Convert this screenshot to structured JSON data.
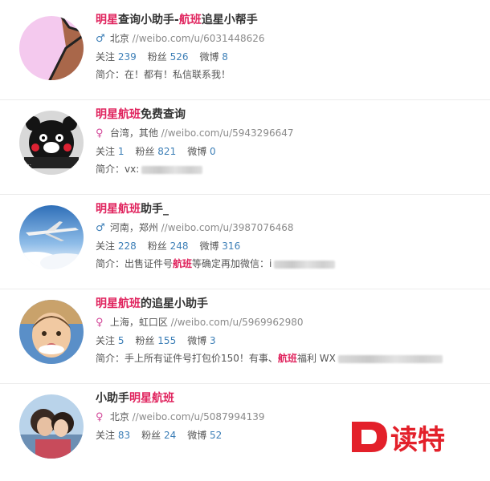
{
  "results": [
    {
      "title_parts": [
        {
          "text": "明星",
          "hl": true
        },
        {
          "text": "查询小助手-",
          "hl": false
        },
        {
          "text": "航班",
          "hl": true
        },
        {
          "text": "追星小帮手",
          "hl": false
        }
      ],
      "gender": "male",
      "location": "北京",
      "url": "//weibo.com/u/6031448626",
      "follow_label": "关注",
      "follow": "239",
      "fans_label": "粉丝",
      "fans": "526",
      "weibo_label": "微博",
      "weibo": "8",
      "bio_label": "简介：",
      "bio_parts": [
        {
          "text": "在！都有！私信联系我！",
          "hl": false
        }
      ],
      "avatar": "pink-abstract"
    },
    {
      "title_parts": [
        {
          "text": "明星",
          "hl": true
        },
        {
          "text": "航班",
          "hl": true
        },
        {
          "text": "免费查询",
          "hl": false
        }
      ],
      "gender": "female",
      "location": "台湾，其他",
      "url": "//weibo.com/u/5943296647",
      "follow_label": "关注",
      "follow": "1",
      "fans_label": "粉丝",
      "fans": "821",
      "weibo_label": "微博",
      "weibo": "0",
      "bio_label": "简介：",
      "bio_parts": [
        {
          "text": "vx:",
          "hl": false
        }
      ],
      "bio_blur": true,
      "avatar": "kumamon"
    },
    {
      "title_parts": [
        {
          "text": "明星",
          "hl": true
        },
        {
          "text": "航班",
          "hl": true
        },
        {
          "text": "助手_",
          "hl": false
        }
      ],
      "gender": "male",
      "location": "河南，郑州",
      "url": "//weibo.com/u/3987076468",
      "follow_label": "关注",
      "follow": "228",
      "fans_label": "粉丝",
      "fans": "248",
      "weibo_label": "微博",
      "weibo": "316",
      "bio_label": "简介：",
      "bio_parts": [
        {
          "text": "出售证件号",
          "hl": false
        },
        {
          "text": "航班",
          "hl": true
        },
        {
          "text": "等确定再加微信：i",
          "hl": false
        }
      ],
      "bio_blur": true,
      "avatar": "airplane"
    },
    {
      "title_parts": [
        {
          "text": "明星",
          "hl": true
        },
        {
          "text": "航班",
          "hl": true
        },
        {
          "text": "的追星小助手",
          "hl": false
        }
      ],
      "gender": "female",
      "location": "上海，虹口区",
      "url": "//weibo.com/u/5969962980",
      "follow_label": "关注",
      "follow": "5",
      "fans_label": "粉丝",
      "fans": "155",
      "weibo_label": "微博",
      "weibo": "3",
      "bio_label": "简介：",
      "bio_parts": [
        {
          "text": "手上所有证件号打包价150！有事、",
          "hl": false
        },
        {
          "text": "航班",
          "hl": true
        },
        {
          "text": "福利 WX",
          "hl": false
        }
      ],
      "bio_blur": true,
      "avatar": "child"
    },
    {
      "title_parts": [
        {
          "text": "小助手",
          "hl": false
        },
        {
          "text": "明星",
          "hl": true
        },
        {
          "text": "航班",
          "hl": true
        }
      ],
      "gender": "female",
      "location": "北京",
      "url": "//weibo.com/u/5087994139",
      "follow_label": "关注",
      "follow": "83",
      "fans_label": "粉丝",
      "fans": "24",
      "weibo_label": "微博",
      "weibo": "52",
      "avatar": "couple"
    }
  ],
  "watermark": {
    "letter": "D",
    "text": "读特"
  },
  "colors": {
    "highlight": "#e0245e",
    "link": "#3d7fb7",
    "male": "#3d7fb7",
    "female": "#d34a9a",
    "watermark": "#e3202a"
  }
}
